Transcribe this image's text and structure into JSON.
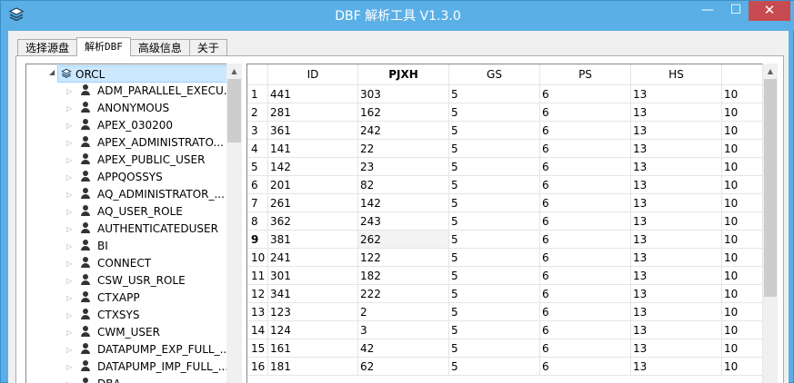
{
  "window": {
    "title": "DBF 解析工具  V1.3.0",
    "minimize": "—",
    "maximize": "☐",
    "close": "✕",
    "colors": {
      "titlebar": "#5ab0e6",
      "close": "#c74b50",
      "selection": "#cce8ff"
    }
  },
  "tabs": [
    {
      "label": "选择源盘",
      "active": false
    },
    {
      "label": "解析DBF",
      "active": true
    },
    {
      "label": "高级信息",
      "active": false
    },
    {
      "label": "关于",
      "active": false
    }
  ],
  "tree": {
    "root": {
      "label": "ORCL",
      "icon": "layers-icon",
      "expanded": true
    },
    "children": [
      "ADM_PARALLEL_EXECU...",
      "ANONYMOUS",
      "APEX_030200",
      "APEX_ADMINISTRATO...",
      "APEX_PUBLIC_USER",
      "APPQOSSYS",
      "AQ_ADMINISTRATOR_...",
      "AQ_USER_ROLE",
      "AUTHENTICATEDUSER",
      "BI",
      "CONNECT",
      "CSW_USR_ROLE",
      "CTXAPP",
      "CTXSYS",
      "CWM_USER",
      "DATAPUMP_EXP_FULL_...",
      "DATAPUMP_IMP_FULL_...",
      "DBA"
    ]
  },
  "grid": {
    "columns": [
      "ID",
      "PJXH",
      "GS",
      "PS",
      "HS",
      ""
    ],
    "bold_column": "PJXH",
    "current_row": 9,
    "rows": [
      {
        "n": "1",
        "cells": [
          "441",
          "303",
          "5",
          "6",
          "13",
          "10"
        ]
      },
      {
        "n": "2",
        "cells": [
          "281",
          "162",
          "5",
          "6",
          "13",
          "10"
        ]
      },
      {
        "n": "3",
        "cells": [
          "361",
          "242",
          "5",
          "6",
          "13",
          "10"
        ]
      },
      {
        "n": "4",
        "cells": [
          "141",
          "22",
          "5",
          "6",
          "13",
          "10"
        ]
      },
      {
        "n": "5",
        "cells": [
          "142",
          "23",
          "5",
          "6",
          "13",
          "10"
        ]
      },
      {
        "n": "6",
        "cells": [
          "201",
          "82",
          "5",
          "6",
          "13",
          "10"
        ]
      },
      {
        "n": "7",
        "cells": [
          "261",
          "142",
          "5",
          "6",
          "13",
          "10"
        ]
      },
      {
        "n": "8",
        "cells": [
          "362",
          "243",
          "5",
          "6",
          "13",
          "10"
        ]
      },
      {
        "n": "9",
        "cells": [
          "381",
          "262",
          "5",
          "6",
          "13",
          "10"
        ]
      },
      {
        "n": "10",
        "cells": [
          "241",
          "122",
          "5",
          "6",
          "13",
          "10"
        ]
      },
      {
        "n": "11",
        "cells": [
          "301",
          "182",
          "5",
          "6",
          "13",
          "10"
        ]
      },
      {
        "n": "12",
        "cells": [
          "341",
          "222",
          "5",
          "6",
          "13",
          "10"
        ]
      },
      {
        "n": "13",
        "cells": [
          "123",
          "2",
          "5",
          "6",
          "13",
          "10"
        ]
      },
      {
        "n": "14",
        "cells": [
          "124",
          "3",
          "5",
          "6",
          "13",
          "10"
        ]
      },
      {
        "n": "15",
        "cells": [
          "161",
          "42",
          "5",
          "6",
          "13",
          "10"
        ]
      },
      {
        "n": "16",
        "cells": [
          "181",
          "62",
          "5",
          "6",
          "13",
          "10"
        ]
      }
    ]
  }
}
